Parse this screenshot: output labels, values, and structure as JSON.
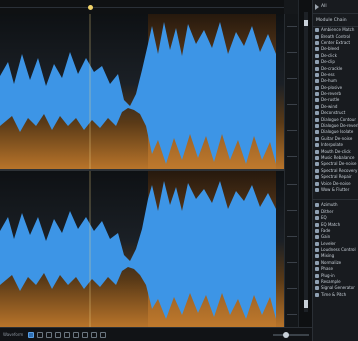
{
  "sidebar": {
    "header_label": "All",
    "selector_label": "Module Chain",
    "modules_group1": [
      "Ambience Match",
      "Breath Control",
      "Center Extract",
      "De-bleed",
      "De-click",
      "De-clip",
      "De-crackle",
      "De-ess",
      "De-hum",
      "De-plosive",
      "De-reverb",
      "De-rustle",
      "De-wind",
      "Deconstruct",
      "Dialogue Contour",
      "Dialogue De-reverb",
      "Dialogue Isolate",
      "Guitar De-noise",
      "Interpolate",
      "Mouth De-click",
      "Music Rebalance",
      "Spectral De-noise",
      "Spectral Recovery",
      "Spectral Repair",
      "Voice De-noise",
      "Wow & Flutter"
    ],
    "modules_group2": [
      "Azimuth",
      "Dither",
      "EQ",
      "EQ Match",
      "Fade",
      "Gain",
      "Leveler",
      "Loudness Control",
      "Mixing",
      "Normalize",
      "Phase",
      "Plug-in",
      "Resample",
      "Signal Generator",
      "Time & Pitch"
    ]
  },
  "colors": {
    "waveform": "#3d95e6",
    "spectrogram_dark": "#1b1e22",
    "spectrogram_warm": "#b06a25"
  },
  "bottom_bar": {
    "time_label": "Waveform"
  }
}
